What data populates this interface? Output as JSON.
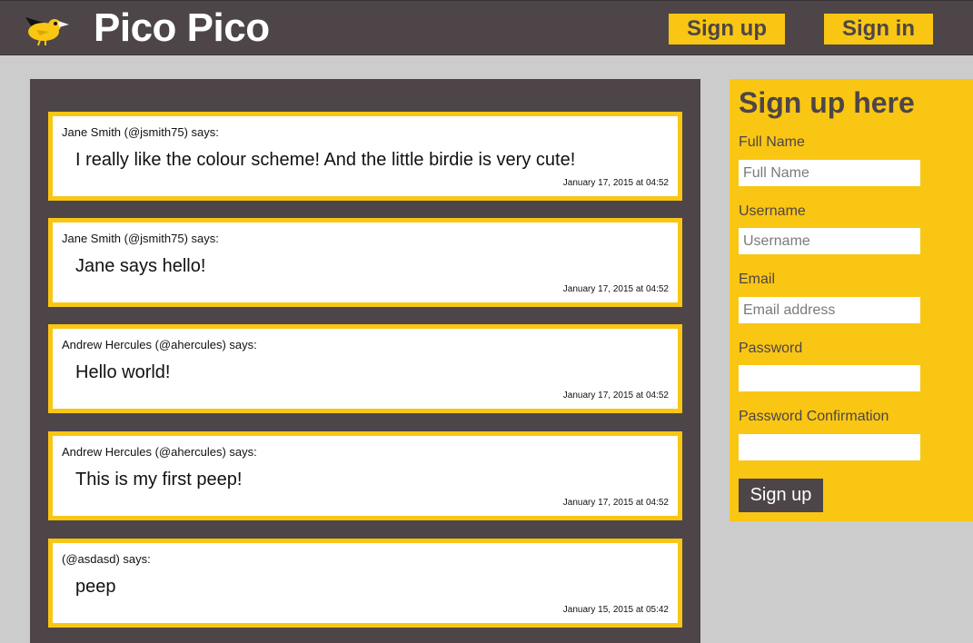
{
  "header": {
    "brand": "Pico Pico",
    "logo_icon": "bird-icon",
    "signup_label": "Sign up",
    "signin_label": "Sign in"
  },
  "colors": {
    "dark": "#4d4547",
    "accent": "#f9c614",
    "page_bg": "#cccccc"
  },
  "peeps": [
    {
      "author": "Jane Smith (@jsmith75) says:",
      "message": "I really like the colour scheme! And the little birdie is very cute!",
      "time": "January 17, 2015 at 04:52"
    },
    {
      "author": "Jane Smith (@jsmith75) says:",
      "message": "Jane says hello!",
      "time": "January 17, 2015 at 04:52"
    },
    {
      "author": "Andrew Hercules (@ahercules) says:",
      "message": "Hello world!",
      "time": "January 17, 2015 at 04:52"
    },
    {
      "author": "Andrew Hercules (@ahercules) says:",
      "message": "This is my first peep!",
      "time": "January 17, 2015 at 04:52"
    },
    {
      "author": "(@asdasd) says:",
      "message": "peep",
      "time": "January 15, 2015 at 05:42"
    }
  ],
  "signup_form": {
    "title": "Sign up here",
    "fields": [
      {
        "label": "Full Name",
        "placeholder": "Full Name",
        "value": ""
      },
      {
        "label": "Username",
        "placeholder": "Username",
        "value": ""
      },
      {
        "label": "Email",
        "placeholder": "Email address",
        "value": ""
      },
      {
        "label": "Password",
        "placeholder": "",
        "value": ""
      },
      {
        "label": "Password Confirmation",
        "placeholder": "",
        "value": ""
      }
    ],
    "submit_label": "Sign up"
  }
}
